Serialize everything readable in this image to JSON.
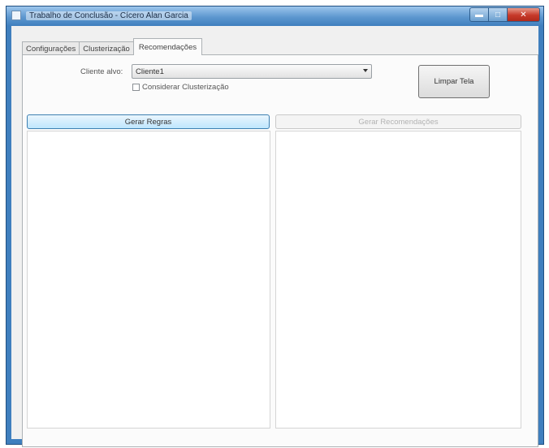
{
  "window": {
    "title": "Trabalho de Conclusão - Cícero Alan Garcia",
    "icon": "app-icon",
    "caption_buttons": {
      "minimize_icon": "minimize-icon",
      "maximize_icon": "maximize-icon",
      "close_icon": "close-icon"
    }
  },
  "tabs": [
    {
      "label": "Configurações",
      "active": false
    },
    {
      "label": "Clusterização",
      "active": false
    },
    {
      "label": "Recomendações",
      "active": true
    }
  ],
  "recomendacoes": {
    "cliente_alvo_label": "Cliente alvo:",
    "cliente_alvo_value": "Cliente1",
    "considerar_clusterizacao_label": "Considerar Clusterização",
    "considerar_clusterizacao_checked": false,
    "limpar_tela_label": "Limpar Tela",
    "gerar_regras_label": "Gerar Regras",
    "gerar_recomendacoes_label": "Gerar Recomendações",
    "gerar_recomendacoes_enabled": false,
    "regras_list": [],
    "recomendacoes_list": []
  },
  "colors": {
    "title_bar": "#3f7fbe",
    "close_button": "#c6392a",
    "focused_button": "#bee6fd"
  }
}
